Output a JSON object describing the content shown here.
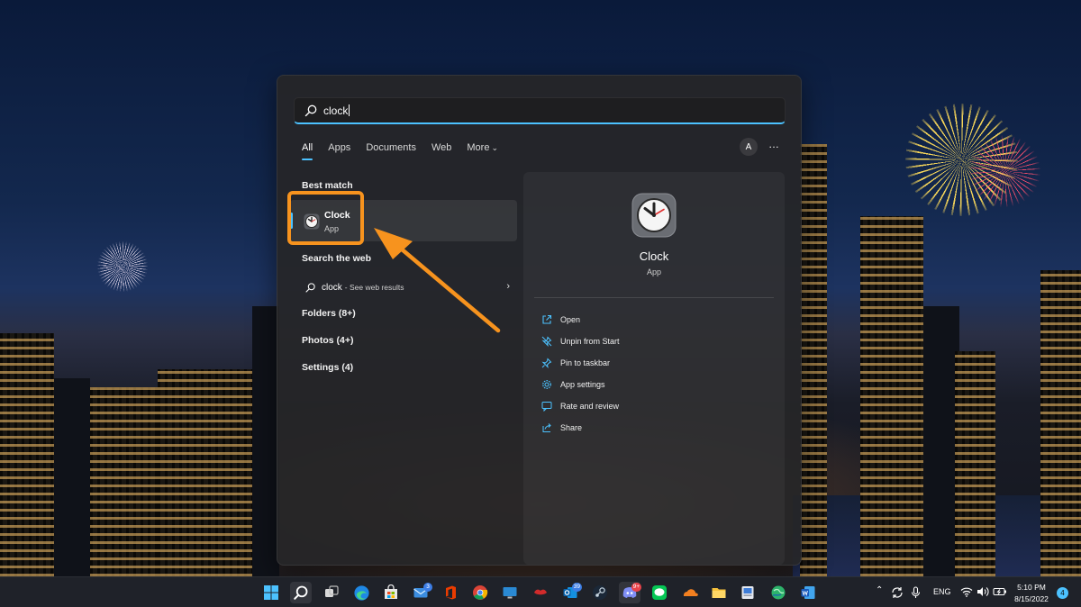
{
  "search": {
    "query": "clock"
  },
  "filters": {
    "tabs": [
      "All",
      "Apps",
      "Documents",
      "Web",
      "More"
    ],
    "active": "All",
    "avatar_letter": "A",
    "overflow": "…"
  },
  "best_match": {
    "heading": "Best match",
    "name": "Clock",
    "type": "App"
  },
  "web": {
    "heading": "Search the web",
    "query": "clock",
    "hint": "- See web results"
  },
  "categories": [
    "Folders (8+)",
    "Photos (4+)",
    "Settings (4)"
  ],
  "details": {
    "name": "Clock",
    "type": "App",
    "actions": [
      {
        "label": "Open",
        "icon": "open-external-icon"
      },
      {
        "label": "Unpin from Start",
        "icon": "unpin-icon"
      },
      {
        "label": "Pin to taskbar",
        "icon": "pin-icon"
      },
      {
        "label": "App settings",
        "icon": "gear-icon"
      },
      {
        "label": "Rate and review",
        "icon": "rate-review-icon"
      },
      {
        "label": "Share",
        "icon": "share-icon"
      }
    ]
  },
  "taskbar": {
    "badges": {
      "mail": "3",
      "outlook": "39",
      "discord": "9+"
    },
    "tray": {
      "language": "ENG",
      "time": "5:10 PM",
      "date": "8/15/2022",
      "notifications": "4"
    }
  },
  "colors": {
    "accent": "#4cc2ff",
    "highlight": "#f7931e"
  }
}
